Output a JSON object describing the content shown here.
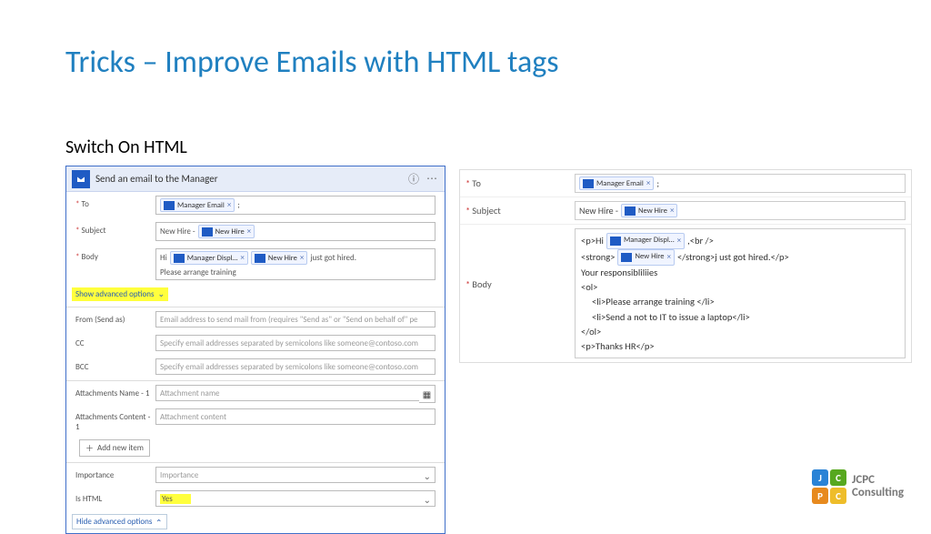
{
  "slide": {
    "title": "Tricks – Improve Emails with HTML tags",
    "subtitle": "Switch On HTML"
  },
  "flow_card": {
    "header_title": "Send an email to the Manager",
    "to_label": "To",
    "to_chip": "Manager Email",
    "to_suffix": ";",
    "subject_label": "Subject",
    "subject_prefix": "New Hire -",
    "subject_chip": "New Hire",
    "body_label": "Body",
    "body_prefix": "Hi",
    "body_chip1": "Manager Displ…",
    "body_chip2": "New Hire",
    "body_line1_suffix": "just got hired.",
    "body_line2": "Please arrange training",
    "show_advanced": "Show advanced options",
    "from_label": "From (Send as)",
    "from_placeholder": "Email address to send mail from (requires \"Send as\" or \"Send on behalf of\" pe",
    "cc_label": "CC",
    "cc_placeholder": "Specify email addresses separated by semicolons like someone@contoso.com",
    "bcc_label": "BCC",
    "bcc_placeholder": "Specify email addresses separated by semicolons like someone@contoso.com",
    "att_name_label": "Attachments Name - 1",
    "att_name_placeholder": "Attachment name",
    "att_content_label": "Attachments Content - 1",
    "att_content_placeholder": "Attachment content",
    "add_new_item": "Add new item",
    "importance_label": "Importance",
    "importance_placeholder": "Importance",
    "is_html_label": "Is HTML",
    "is_html_value": "Yes",
    "hide_advanced": "Hide advanced options"
  },
  "right": {
    "to_label": "To",
    "to_chip": "Manager Email",
    "to_suffix": ";",
    "subject_label": "Subject",
    "subject_prefix": "New Hire -",
    "subject_chip": "New Hire",
    "body_label": "Body",
    "body_l1_a": "<p>Hi",
    "body_l1_chip": "Manager Displ…",
    "body_l1_b": ",<br />",
    "body_l2_a": "<strong>",
    "body_l2_chip": "New Hire",
    "body_l2_b": "</strong>j ust got hired.</p>",
    "body_l3": "Your responsibliliies",
    "body_l4": "<ol>",
    "body_l5": "<li>Please arrange training </li>",
    "body_l6": "<li>Send a not to IT to issue a laptop</li>",
    "body_l7": "</ol>",
    "body_l8": "<p>Thanks HR</p>"
  },
  "logo": {
    "line1": "JCPC",
    "line2": "Consulting",
    "t1": "J",
    "t2": "C",
    "t3": "P",
    "t4": "C"
  }
}
